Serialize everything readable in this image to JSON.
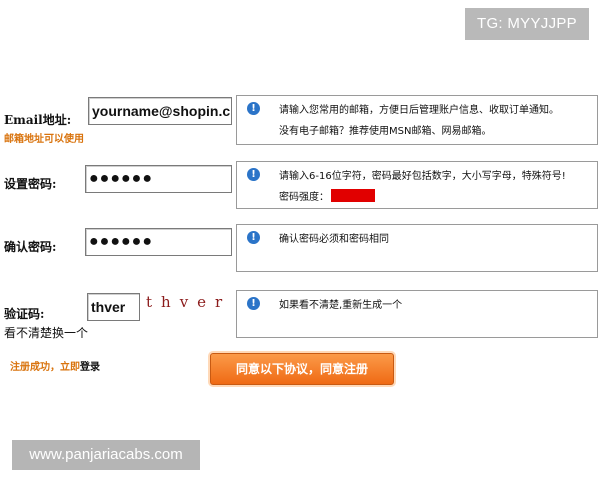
{
  "watermarks": {
    "top": "TG: MYYJJPP",
    "bottom": "www.panjariacabs.com"
  },
  "email": {
    "label": "Email地址:",
    "note": "邮箱地址可以使用",
    "value": "yourname@shopin.cn",
    "tip_line1": "请输入您常用的邮箱，方便日后管理账户信息、收取订单通知。",
    "tip_line2": "没有电子邮箱？推荐使用MSN邮箱、网易邮箱。"
  },
  "password": {
    "label": "设置密码:",
    "value": "●●●●●●",
    "tip_line1": "请输入6-16位字符，密码最好包括数字，大小写字母，特殊符号!",
    "strength_label": "密码强度：",
    "strength_color": "#e10000"
  },
  "confirm": {
    "label": "确认密码:",
    "value": "●●●●●●",
    "tip_line1": "确认密码必须和密码相同"
  },
  "captcha": {
    "label": "验证码:",
    "value": "thver",
    "image_text": "thver",
    "refresh_link": "看不清楚换一个",
    "tip_line1": "如果看不清楚,重新生成一个"
  },
  "footer": {
    "success_text": "注册成功，立即",
    "login_link": "登录",
    "submit_label": "同意以下协议，同意注册"
  },
  "icons": {
    "info": "info-icon"
  },
  "colors": {
    "accent_orange": "#d9730d",
    "button_orange": "#ef6a14",
    "info_blue": "#2b74c8"
  }
}
